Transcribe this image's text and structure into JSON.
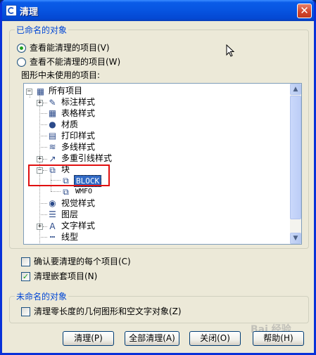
{
  "window": {
    "title": "清理"
  },
  "named_group": {
    "legend": "已命名的对象",
    "radio_purgeable": "查看能清理的项目(V)",
    "radio_nonpurgeable": "查看不能清理的项目(W)",
    "unused_label": "图形中未使用的项目:"
  },
  "tree": {
    "root": "所有项目",
    "items": [
      {
        "label": "标注样式",
        "icon": "dimension-style-icon"
      },
      {
        "label": "表格样式",
        "icon": "table-style-icon"
      },
      {
        "label": "材质",
        "icon": "material-icon"
      },
      {
        "label": "打印样式",
        "icon": "plot-style-icon"
      },
      {
        "label": "多线样式",
        "icon": "mline-style-icon"
      },
      {
        "label": "多重引线样式",
        "icon": "mleader-style-icon"
      },
      {
        "label": "块",
        "icon": "block-icon"
      },
      {
        "label": "BLOCK",
        "icon": "block-icon"
      },
      {
        "label": "WMFO",
        "icon": "block-icon"
      },
      {
        "label": "视觉样式",
        "icon": "visual-style-icon"
      },
      {
        "label": "图层",
        "icon": "layer-icon"
      },
      {
        "label": "文字样式",
        "icon": "text-style-icon"
      },
      {
        "label": "线型",
        "icon": "linetype-icon"
      }
    ]
  },
  "options": {
    "confirm_each": "确认要清理的每个项目(C)",
    "purge_nested": "清理嵌套项目(N)"
  },
  "unnamed_group": {
    "legend": "未命名的对象",
    "zero_length": "清理零长度的几何图形和空文字对象(Z)"
  },
  "buttons": {
    "purge": "清理(P)",
    "purge_all": "全部清理(A)",
    "close": "关闭(O)",
    "help": "帮助(H)"
  },
  "watermark": "Bai 经验",
  "colors": {
    "title_bar": "#0754e0",
    "group_legend": "#0046d5",
    "selection": "#316ac5",
    "annotation": "#e01010"
  }
}
